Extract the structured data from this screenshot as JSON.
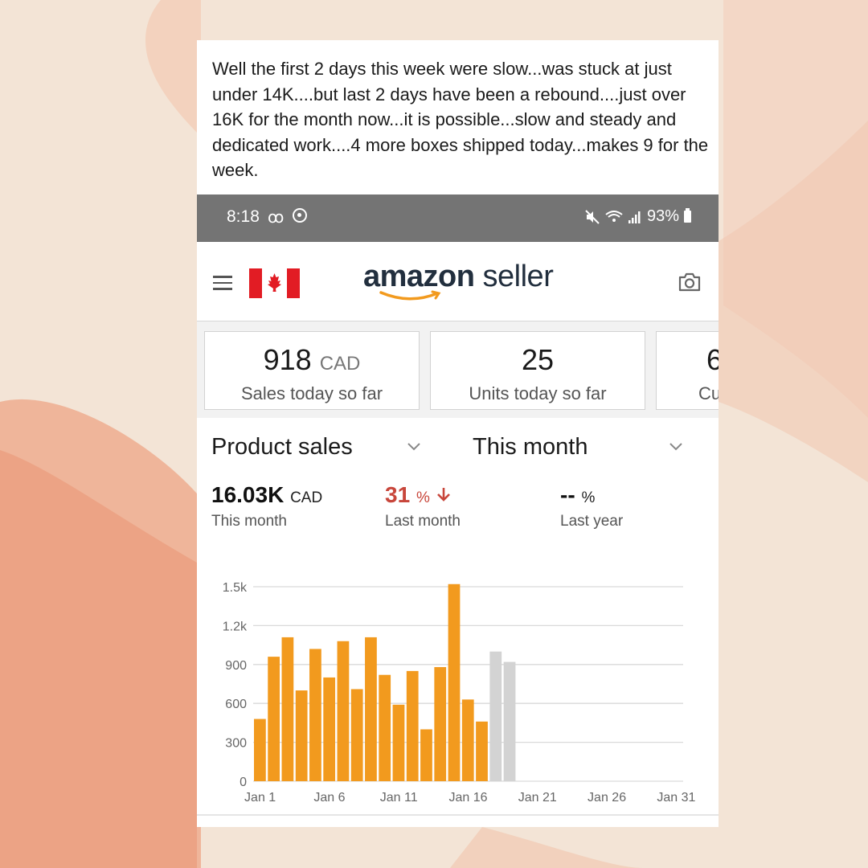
{
  "post": {
    "text": "Well the first 2 days this week were slow...was stuck at just under 14K....but last 2 days have been a rebound....just over 16K for the month now...it is possible...slow and steady and dedicated work....4 more boxes shipped today...makes 9 for the week."
  },
  "status_bar": {
    "time": "8:18",
    "voicemail_icon": "voicemail-icon",
    "battery": "93%"
  },
  "app": {
    "logo_bold": "amazon",
    "logo_light": " seller",
    "accent_color": "#f29a1e"
  },
  "tiles": [
    {
      "value": "918",
      "unit": "CAD",
      "label": "Sales today so far"
    },
    {
      "value": "25",
      "unit": "",
      "label": "Units today so far"
    },
    {
      "value": "6",
      "unit": "",
      "label": "Cu"
    }
  ],
  "selectors": {
    "metric": "Product sales",
    "period": "This month"
  },
  "metrics": {
    "this_month_value": "16.03K",
    "this_month_unit": "CAD",
    "this_month_label": "This month",
    "last_month_value": "31",
    "last_month_unit": "%",
    "last_month_label": "Last month",
    "last_year_value": "--",
    "last_year_unit": "%",
    "last_year_label": "Last year"
  },
  "chart_data": {
    "type": "bar",
    "x": [
      1,
      2,
      3,
      4,
      5,
      6,
      7,
      8,
      9,
      10,
      11,
      12,
      13,
      14,
      15,
      16,
      17,
      18,
      19
    ],
    "values": [
      480,
      960,
      1110,
      700,
      1020,
      800,
      1080,
      710,
      1110,
      820,
      590,
      850,
      400,
      880,
      1520,
      630,
      460,
      1000,
      920
    ],
    "projected_from_index": 17,
    "colors": {
      "actual": "#f29a1e",
      "projected": "#d3d3d3"
    },
    "x_ticks": [
      "Jan 1",
      "Jan 6",
      "Jan 11",
      "Jan 16",
      "Jan 21",
      "Jan 26",
      "Jan 31"
    ],
    "x_tick_days": [
      1,
      6,
      11,
      16,
      21,
      26,
      31
    ],
    "y_ticks": [
      "0",
      "300",
      "600",
      "900",
      "1.2k",
      "1.5k"
    ],
    "y_tick_values": [
      0,
      300,
      600,
      900,
      1200,
      1500
    ],
    "ylim": [
      0,
      1500
    ],
    "xlim": [
      1,
      31
    ],
    "grid": true
  }
}
